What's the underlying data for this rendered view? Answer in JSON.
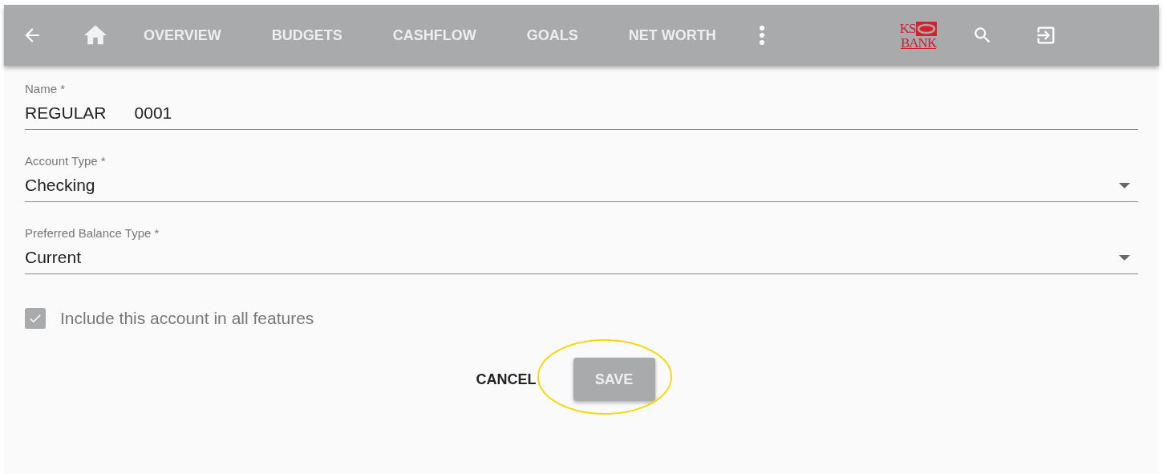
{
  "toolbar": {
    "nav": [
      {
        "label": "OVERVIEW",
        "selected": false
      },
      {
        "label": "BUDGETS",
        "selected": false
      },
      {
        "label": "CASHFLOW",
        "selected": false
      },
      {
        "label": "GOALS",
        "selected": false
      },
      {
        "label": "NET WORTH",
        "selected": false
      }
    ],
    "logo": {
      "line_1": "KS",
      "line_2": "BANK"
    }
  },
  "form": {
    "fields": [
      {
        "kind": "text",
        "label": "Name *",
        "value": "REGULAR      0001"
      },
      {
        "kind": "select",
        "label": "Account Type *",
        "value": "Checking"
      },
      {
        "kind": "select",
        "label": "Preferred Balance Type *",
        "value": "Current"
      }
    ],
    "checkbox": {
      "label": "Include this account in all features",
      "checked": true
    },
    "buttons": [
      {
        "kind": "flat",
        "label": "CANCEL",
        "disabled": false
      },
      {
        "kind": "raised",
        "label": "SAVE",
        "disabled": true,
        "highlighted": true
      }
    ]
  }
}
